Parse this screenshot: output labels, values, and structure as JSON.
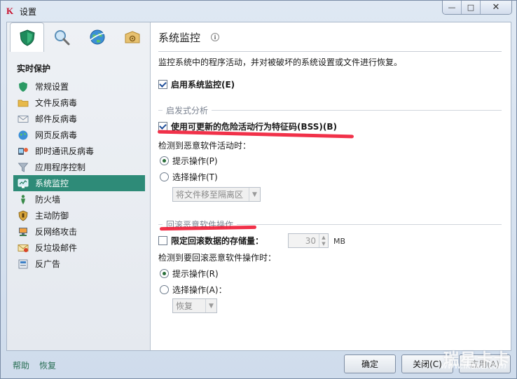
{
  "window": {
    "title": "设置",
    "controls": [
      "—",
      "□",
      "✕"
    ]
  },
  "tabs": [
    {
      "name": "protection-tab",
      "icon": "shield-icon"
    },
    {
      "name": "scan-tab",
      "icon": "magnifier-icon"
    },
    {
      "name": "update-tab",
      "icon": "globe-icon"
    },
    {
      "name": "options-tab",
      "icon": "settings-box-icon"
    }
  ],
  "sidebar": {
    "heading": "实时保护",
    "items": [
      {
        "label": "常规设置",
        "icon": "shield-icon"
      },
      {
        "label": "文件反病毒",
        "icon": "folder-icon"
      },
      {
        "label": "邮件反病毒",
        "icon": "mail-icon"
      },
      {
        "label": "网页反病毒",
        "icon": "globe-icon"
      },
      {
        "label": "即时通讯反病毒",
        "icon": "chat-icon"
      },
      {
        "label": "应用程序控制",
        "icon": "filter-icon"
      },
      {
        "label": "系统监控",
        "icon": "monitor-icon",
        "selected": true
      },
      {
        "label": "防火墙",
        "icon": "firewall-icon"
      },
      {
        "label": "主动防御",
        "icon": "defense-icon"
      },
      {
        "label": "反网络攻击",
        "icon": "network-icon"
      },
      {
        "label": "反垃圾邮件",
        "icon": "spam-icon"
      },
      {
        "label": "反广告",
        "icon": "ad-icon"
      }
    ],
    "help_link": "帮助",
    "restore_link": "恢复"
  },
  "main": {
    "title": "系统监控",
    "description": "监控系统中的程序活动，并对被破坏的系统设置或文件进行恢复。",
    "enable_label": "启用系统监控(E)",
    "heuristic": {
      "group_label": "启发式分析",
      "bss_label": "使用可更新的危险活动行为特征码(BSS)(B)",
      "detect_label": "检测到恶意软件活动时：",
      "prompt_label": "提示操作(P)",
      "select_label": "选择操作(T)",
      "select_value": "将文件移至隔离区"
    },
    "rollback": {
      "group_label": "回滚恶意软件操作",
      "limit_label": "限定回滚数据的存储量：",
      "limit_value": "30",
      "limit_unit": "MB",
      "detect_label": "检测到要回滚恶意软件操作时：",
      "prompt_label": "提示操作(R)",
      "select_label": "选择操作(A)：",
      "select_value": "恢复"
    }
  },
  "footer": {
    "ok_label": "确定",
    "close_label": "关闭(C)",
    "apply_label": "应用(A)"
  },
  "watermark": {
    "brand": "瑞星卡卡",
    "url": "www.ikaka.com"
  },
  "colors": {
    "selected_bg": "#2e8b78",
    "link": "#2a6f55",
    "annotation": "#f0203a"
  }
}
